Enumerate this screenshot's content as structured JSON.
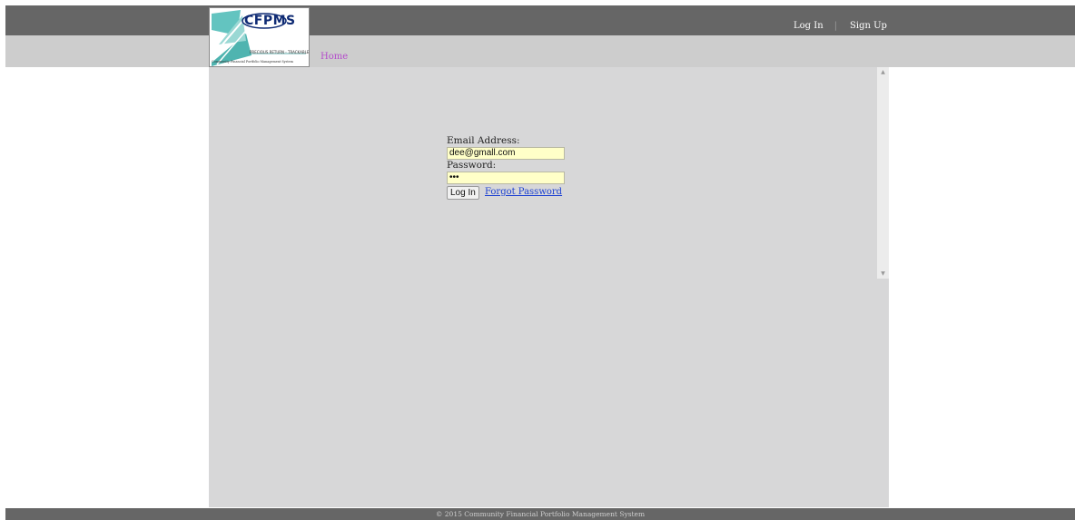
{
  "header": {
    "logo": {
      "text": "CFPMS",
      "tagline": "PRECIOUS RETURN - TRACKABLE",
      "full_name": "Community Financial Portfolio Management System"
    },
    "auth_links": {
      "login": "Log In",
      "separator": "|",
      "signup": "Sign Up"
    }
  },
  "nav": {
    "home": "Home"
  },
  "login_form": {
    "email_label": "Email Address:",
    "email_value": "dee@gmall.com",
    "password_label": "Password:",
    "password_value": "•••",
    "login_button": "Log In",
    "forgot_password": "Forgot Password"
  },
  "footer": {
    "copyright": "© 2015 Community Financial Portfolio Management System"
  },
  "colors": {
    "topbar": "#666666",
    "navbar": "#cdcdcd",
    "content_bg": "#d7d7d8",
    "home_link": "#b44bcc",
    "input_bg": "#ffffc8",
    "link": "#1a3fd1"
  },
  "icons": {
    "scroll_up": "chevron-up-icon",
    "scroll_down": "chevron-down-icon"
  }
}
